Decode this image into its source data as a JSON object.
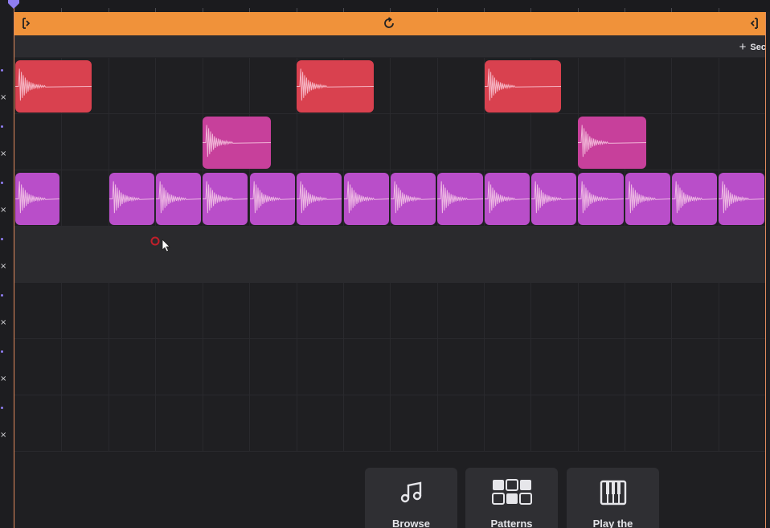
{
  "timeline": {
    "loop_start_icon": "loop-start-bracket-icon",
    "loop_icon": "loop-icon",
    "loop_end_icon": "loop-end-bracket-icon",
    "colors": {
      "loop_bar": "#f0923a",
      "playhead": "#8f7df0"
    }
  },
  "section_bar": {
    "add_label": "Sec",
    "add_icon": "plus-icon"
  },
  "tracks": [
    {
      "color": "#d9414f",
      "clip_count": 3
    },
    {
      "color": "#c7409b",
      "clip_count": 2
    },
    {
      "color": "#b94ec9",
      "clip_count": 15
    },
    {
      "color": "",
      "clip_count": 0
    },
    {
      "color": "",
      "clip_count": 0
    },
    {
      "color": "",
      "clip_count": 0
    },
    {
      "color": "",
      "clip_count": 0
    }
  ],
  "cards": [
    {
      "label": "Browse",
      "icon": "music-note-icon"
    },
    {
      "label": "Patterns",
      "icon": "grid-pattern-icon"
    },
    {
      "label": "Play the",
      "icon": "piano-keys-icon"
    }
  ]
}
